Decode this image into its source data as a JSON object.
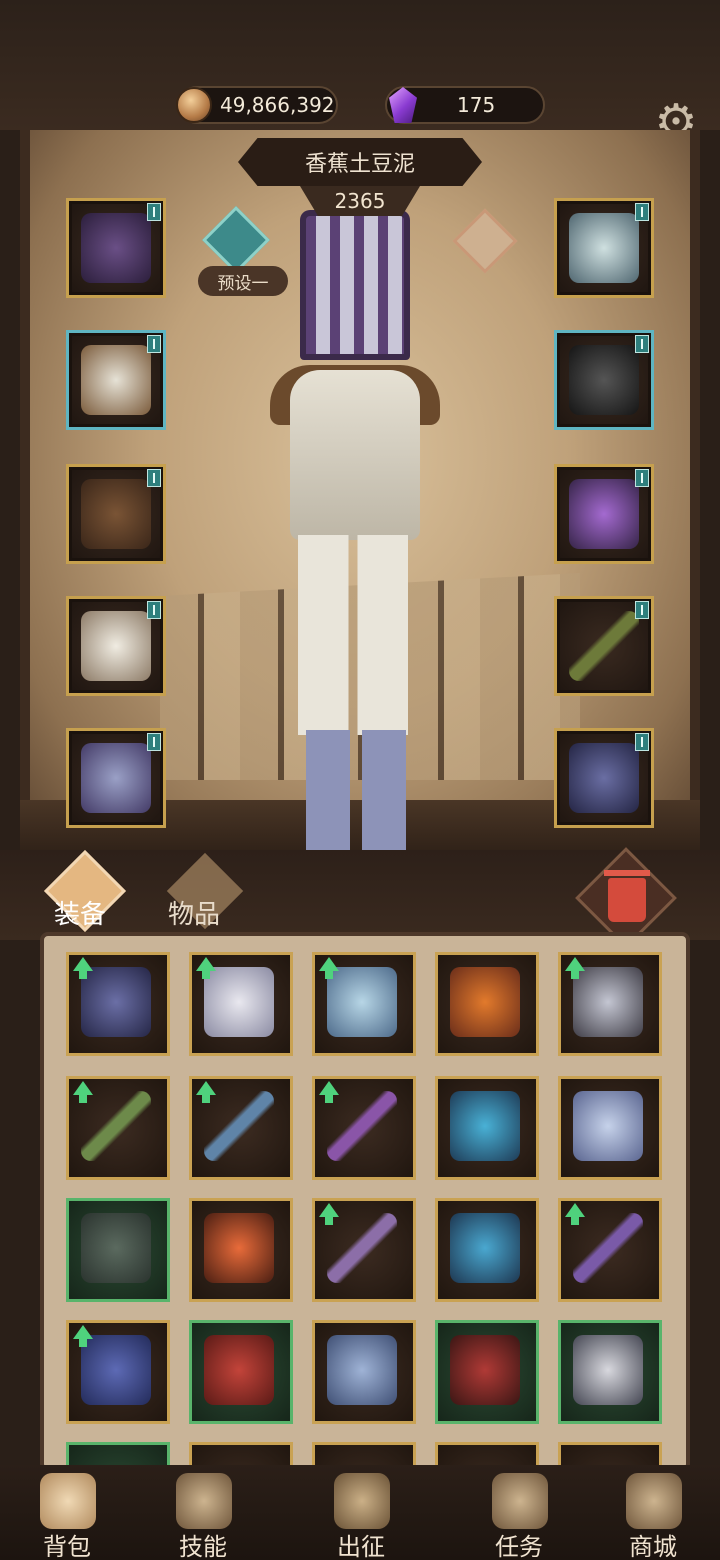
{
  "currency": {
    "gold": "49,866,392",
    "gems": "175"
  },
  "hero": {
    "name": "香蕉土豆泥",
    "power": "2365",
    "preset_label": "预设一"
  },
  "tabs": {
    "equip": "装备",
    "items": "物品"
  },
  "nav": [
    {
      "label": "背包"
    },
    {
      "label": "技能"
    },
    {
      "label": "出征"
    },
    {
      "label": "任务"
    },
    {
      "label": "商城"
    }
  ],
  "colors": {
    "gold_border": "#c9a253",
    "rare_border": "#5fb5c2",
    "green_border": "#59b46b",
    "upgrade": "#4fd27d"
  },
  "icons": {
    "settings": "gear-icon",
    "trash": "trash-icon"
  }
}
